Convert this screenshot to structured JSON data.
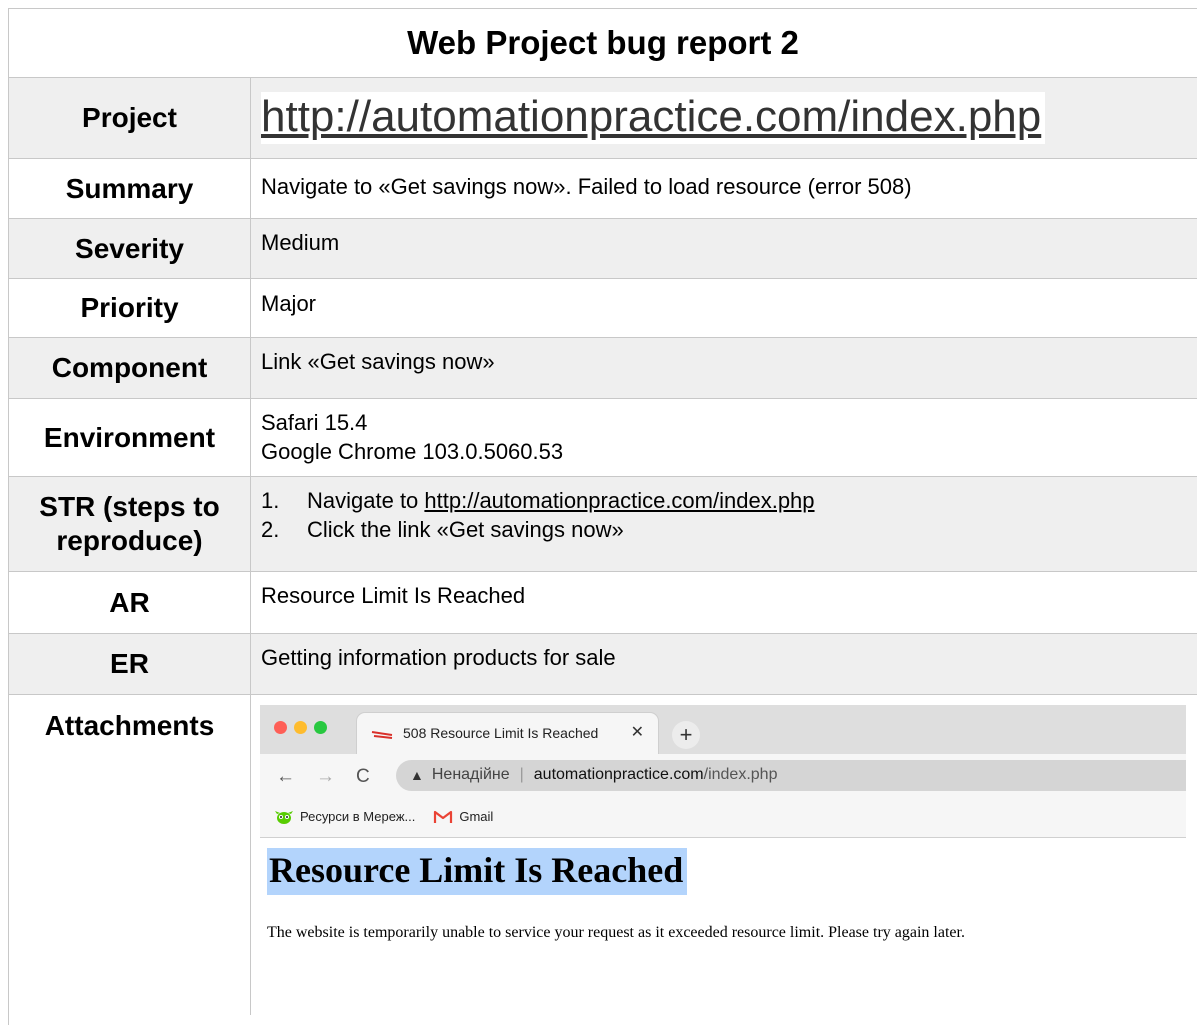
{
  "title": "Web Project bug report 2",
  "rows": {
    "project": {
      "label": "Project",
      "value": "http://automationpractice.com/index.php"
    },
    "summary": {
      "label": "Summary",
      "value": "Navigate to «Get savings now». Failed to load resource (error 508)"
    },
    "severity": {
      "label": "Severity",
      "value": "Medium"
    },
    "priority": {
      "label": "Priority",
      "value": "Major"
    },
    "component": {
      "label": "Component",
      "value": "Link «Get savings now»"
    },
    "environment": {
      "label": "Environment",
      "lines": [
        "Safari 15.4",
        "Google Chrome 103.0.5060.53"
      ]
    },
    "str": {
      "label": "STR (steps to reproduce)",
      "steps": [
        {
          "num": "1.",
          "text": "Navigate to ",
          "link": "http://automationpractice.com/index.php"
        },
        {
          "num": "2.",
          "text": "Click the link «Get savings now»"
        }
      ]
    },
    "ar": {
      "label": "AR",
      "value": "Resource Limit Is Reached"
    },
    "er": {
      "label": "ER",
      "value": "Getting information products for sale"
    },
    "attachments": {
      "label": "Attachments"
    }
  },
  "screenshot": {
    "tab_title": "508 Resource Limit Is Reached",
    "tab_close": "✕",
    "new_tab": "+",
    "nav": {
      "back": "←",
      "forward": "→",
      "reload": "C"
    },
    "address": {
      "warning_icon": "▲",
      "security_text": "Ненадійне",
      "separator": "|",
      "host": "automationpractice.com",
      "path": "/index.php"
    },
    "bookmarks": [
      {
        "icon": "duolingo-owl-icon",
        "label": "Ресурси в Мереж..."
      },
      {
        "icon": "gmail-icon",
        "label": "Gmail"
      }
    ],
    "page_heading": "Resource Limit Is Reached",
    "page_text": "The website is temporarily unable to service your request as it exceeded resource limit. Please try again later.",
    "colors": {
      "close": "#fe5f57",
      "minimize": "#febc2e",
      "zoom": "#28c840",
      "selection": "#b3d4fc"
    }
  }
}
